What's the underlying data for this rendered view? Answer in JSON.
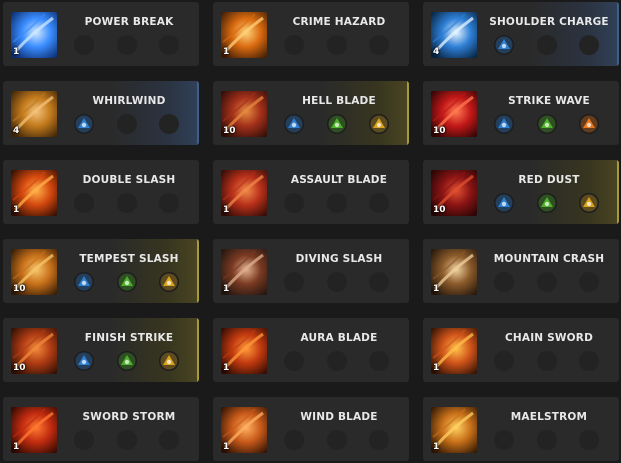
{
  "skills": [
    {
      "name": "POWER BREAK",
      "level": "1",
      "icon": "power-break-icon",
      "glow": "",
      "runes": [
        "",
        "",
        ""
      ]
    },
    {
      "name": "CRIME HAZARD",
      "level": "1",
      "icon": "crime-hazard-icon",
      "glow": "",
      "runes": [
        "",
        "",
        ""
      ]
    },
    {
      "name": "SHOULDER CHARGE",
      "level": "4",
      "icon": "shoulder-charge-icon",
      "glow": "blue",
      "runes": [
        "blue-rune",
        "",
        ""
      ]
    },
    {
      "name": "WHIRLWIND",
      "level": "4",
      "icon": "whirlwind-icon",
      "glow": "blue",
      "runes": [
        "blue-rune",
        "",
        ""
      ]
    },
    {
      "name": "HELL BLADE",
      "level": "10",
      "icon": "hell-blade-icon",
      "glow": "gold",
      "runes": [
        "blue-rune",
        "green-rune",
        "gold-rune"
      ]
    },
    {
      "name": "STRIKE WAVE",
      "level": "10",
      "icon": "strike-wave-icon",
      "glow": "",
      "runes": [
        "blue-rune",
        "green-rune",
        "orange-rune"
      ]
    },
    {
      "name": "DOUBLE SLASH",
      "level": "1",
      "icon": "double-slash-icon",
      "glow": "",
      "runes": [
        "",
        "",
        ""
      ]
    },
    {
      "name": "ASSAULT BLADE",
      "level": "1",
      "icon": "assault-blade-icon",
      "glow": "",
      "runes": [
        "",
        "",
        ""
      ]
    },
    {
      "name": "RED DUST",
      "level": "10",
      "icon": "red-dust-icon",
      "glow": "gold",
      "runes": [
        "blue-rune",
        "green-rune",
        "gold-rune"
      ]
    },
    {
      "name": "TEMPEST SLASH",
      "level": "10",
      "icon": "tempest-slash-icon",
      "glow": "gold",
      "runes": [
        "blue-rune",
        "green-rune",
        "gold-rune"
      ]
    },
    {
      "name": "DIVING SLASH",
      "level": "1",
      "icon": "diving-slash-icon",
      "glow": "",
      "runes": [
        "",
        "",
        ""
      ]
    },
    {
      "name": "MOUNTAIN CRASH",
      "level": "1",
      "icon": "mountain-crash-icon",
      "glow": "",
      "runes": [
        "",
        "",
        ""
      ]
    },
    {
      "name": "FINISH STRIKE",
      "level": "10",
      "icon": "finish-strike-icon",
      "glow": "gold",
      "runes": [
        "blue-rune",
        "green-rune",
        "gold-rune"
      ]
    },
    {
      "name": "AURA BLADE",
      "level": "1",
      "icon": "aura-blade-icon",
      "glow": "",
      "runes": [
        "",
        "",
        ""
      ]
    },
    {
      "name": "CHAIN SWORD",
      "level": "1",
      "icon": "chain-sword-icon",
      "glow": "",
      "runes": [
        "",
        "",
        ""
      ]
    },
    {
      "name": "SWORD STORM",
      "level": "1",
      "icon": "sword-storm-icon",
      "glow": "",
      "runes": [
        "",
        "",
        ""
      ]
    },
    {
      "name": "WIND BLADE",
      "level": "1",
      "icon": "wind-blade-icon",
      "glow": "",
      "runes": [
        "",
        "",
        ""
      ]
    },
    {
      "name": "MAELSTROM",
      "level": "1",
      "icon": "maelstrom-icon",
      "glow": "",
      "runes": [
        "",
        "",
        ""
      ]
    }
  ],
  "colors": {
    "rune_blue": "#2f7fd0",
    "rune_green": "#4fb02a",
    "rune_gold": "#d9a21f",
    "rune_orange": "#e5781c",
    "glow_blue": "#3f5f87",
    "glow_gold": "#a89a3a"
  }
}
